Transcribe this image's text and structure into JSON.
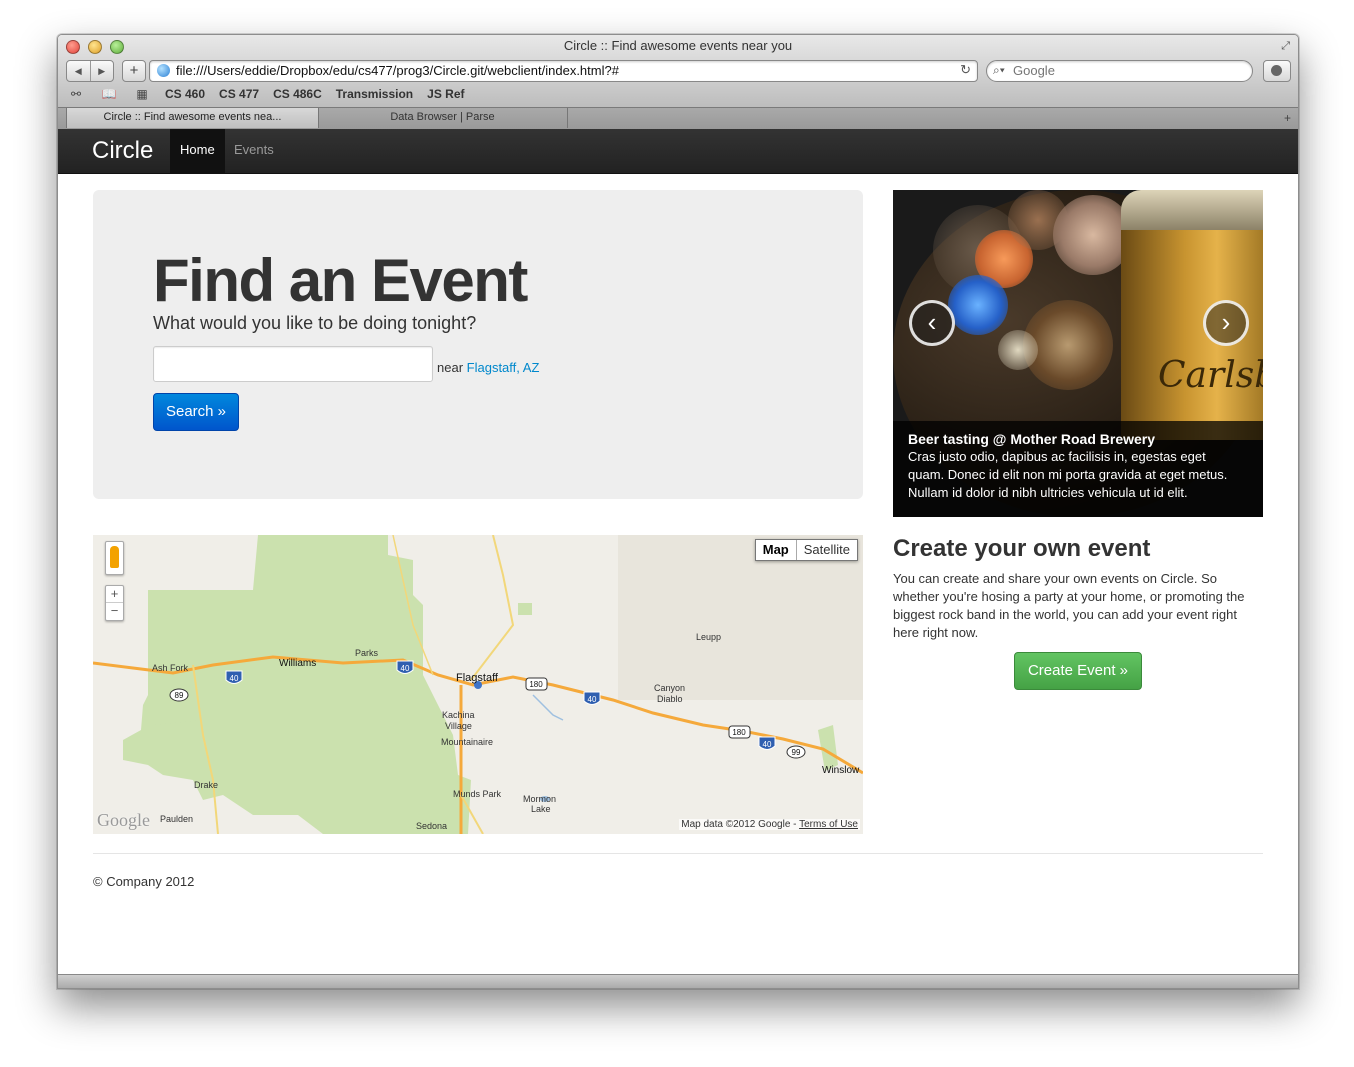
{
  "window": {
    "title": "Circle :: Find awesome events near you",
    "url": "file:///Users/eddie/Dropbox/edu/cs477/prog3/Circle.git/webclient/index.html?#",
    "search_placeholder": "Google"
  },
  "bookmarks": [
    "CS 460",
    "CS 477",
    "CS 486C",
    "Transmission",
    "JS Ref"
  ],
  "tabs": [
    {
      "label": "Circle :: Find awesome events nea...",
      "active": true
    },
    {
      "label": "Data Browser | Parse",
      "active": false
    }
  ],
  "navbar": {
    "brand": "Circle",
    "items": [
      "Home",
      "Events"
    ],
    "active": "Home"
  },
  "hero": {
    "heading": "Find an Event",
    "lead": "What would you like to be doing tonight?",
    "input_value": "",
    "near_label": "near",
    "location": "Flagstaff, AZ",
    "search_button": "Search »"
  },
  "carousel": {
    "caption_title": "Beer tasting @ Mother Road Brewery",
    "caption_text": "Cras justo odio, dapibus ac facilisis in, egestas eget quam. Donec id elit non mi porta gravida at eget metus. Nullam id dolor id nibh ultricies vehicula ut id elit.",
    "prev": "‹",
    "next": "›",
    "image_text": "Carlsberg"
  },
  "map": {
    "type_buttons": [
      "Map",
      "Satellite"
    ],
    "selected_type": "Map",
    "zoom_in": "+",
    "zoom_out": "−",
    "logo": "Google",
    "attribution": "Map data ©2012 Google - ",
    "terms": "Terms of Use",
    "places": {
      "ash_fork": "Ash Fork",
      "williams": "Williams",
      "parks": "Parks",
      "flagstaff": "Flagstaff",
      "kachina1": "Kachina",
      "kachina2": "Village",
      "mountainaire": "Mountainaire",
      "leupp": "Leupp",
      "canyon1": "Canyon",
      "canyon2": "Diablo",
      "drake": "Drake",
      "munds_park": "Munds Park",
      "mormon1": "Mormon",
      "mormon2": "Lake",
      "winslow": "Winslow",
      "paulden": "Paulden",
      "sedona": "Sedona"
    },
    "shields": {
      "i40": "40",
      "us180": "180",
      "sr89": "89",
      "sr99": "99"
    }
  },
  "create": {
    "heading": "Create your own event",
    "text": "You can create and share your own events on Circle. So whether you're hosing a party at your home, or promoting the biggest rock band in the world, you can add your event right here right now.",
    "button": "Create Event »"
  },
  "footer": "© Company 2012"
}
